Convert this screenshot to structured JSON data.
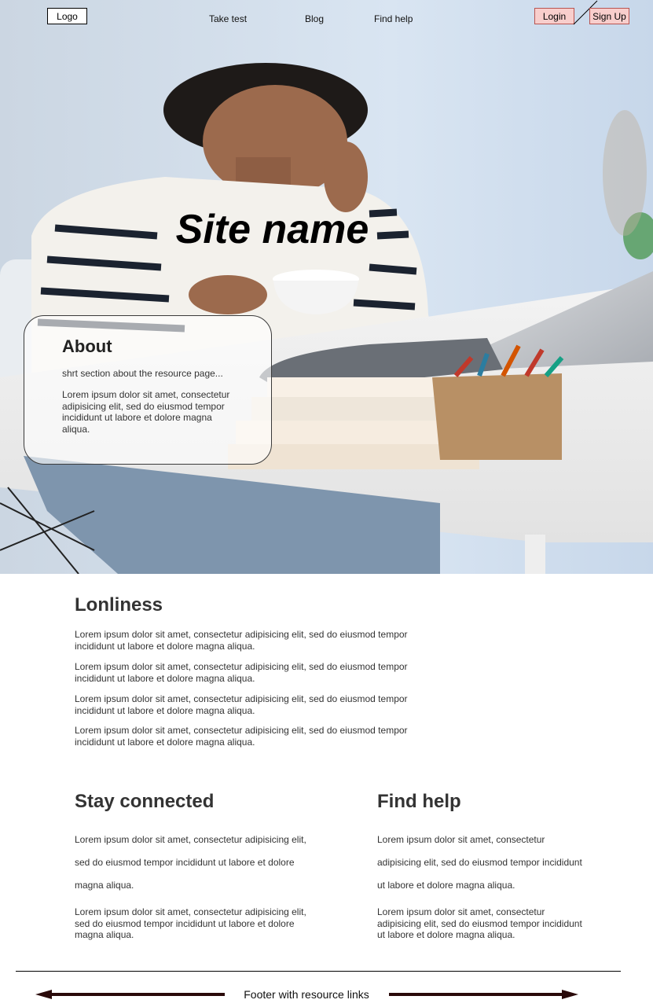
{
  "header": {
    "logo": "Logo",
    "nav": [
      "Take test",
      "Blog",
      "Find help"
    ],
    "login": "Login",
    "signup": "Sign Up"
  },
  "hero": {
    "site_name": "Site name",
    "about": {
      "title": "About",
      "subtitle": "shrt section about the resource page...",
      "text": "Lorem ipsum dolor sit amet, consectetur adipisicing elit, sed do eiusmod tempor incididunt ut labore et dolore magna aliqua."
    }
  },
  "loneliness": {
    "title": "Lonliness",
    "paragraphs": [
      "Lorem ipsum dolor sit amet, consectetur adipisicing elit, sed do eiusmod tempor incididunt ut labore et dolore magna aliqua.",
      "Lorem ipsum dolor sit amet, consectetur adipisicing elit, sed do eiusmod tempor incididunt ut labore et dolore magna aliqua.",
      "Lorem ipsum dolor sit amet, consectetur adipisicing elit, sed do eiusmod tempor incididunt ut labore et dolore magna aliqua.",
      "Lorem ipsum dolor sit amet, consectetur adipisicing elit, sed do eiusmod tempor incididunt ut labore et dolore magna aliqua."
    ]
  },
  "stay_connected": {
    "title": "Stay connected",
    "paragraphs": [
      "Lorem ipsum dolor sit amet, consectetur adipisicing elit, sed do eiusmod tempor incididunt ut labore et dolore magna aliqua.",
      "Lorem ipsum dolor sit amet, consectetur adipisicing elit, sed do eiusmod tempor incididunt ut labore et dolore magna aliqua."
    ]
  },
  "find_help": {
    "title": "Find help",
    "paragraphs": [
      "Lorem ipsum dolor sit amet, consectetur adipisicing elit, sed do eiusmod tempor incididunt ut labore et dolore magna aliqua.",
      "Lorem ipsum dolor sit amet, consectetur adipisicing elit, sed do eiusmod tempor incididunt ut labore et dolore magna aliqua."
    ]
  },
  "footer": {
    "text": "Footer with resource links"
  },
  "colors": {
    "button_fill": "#f8cecc",
    "button_border": "#b85450",
    "arrow": "#2a0a0a"
  },
  "icons": {
    "footer_arrows": "double-arrow-icon"
  }
}
